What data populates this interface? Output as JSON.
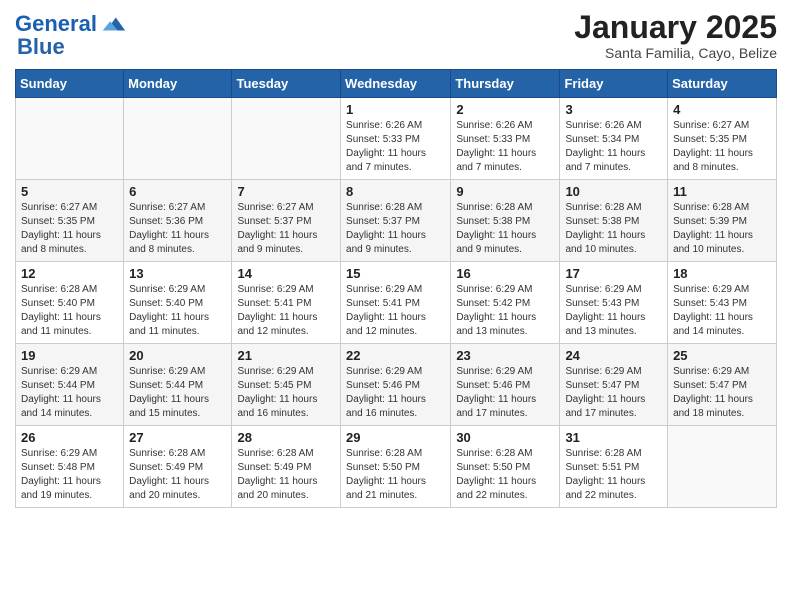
{
  "header": {
    "logo_line1": "General",
    "logo_line2": "Blue",
    "month_title": "January 2025",
    "subtitle": "Santa Familia, Cayo, Belize"
  },
  "weekdays": [
    "Sunday",
    "Monday",
    "Tuesday",
    "Wednesday",
    "Thursday",
    "Friday",
    "Saturday"
  ],
  "weeks": [
    [
      {
        "day": "",
        "sunrise": "",
        "sunset": "",
        "daylight": ""
      },
      {
        "day": "",
        "sunrise": "",
        "sunset": "",
        "daylight": ""
      },
      {
        "day": "",
        "sunrise": "",
        "sunset": "",
        "daylight": ""
      },
      {
        "day": "1",
        "sunrise": "Sunrise: 6:26 AM",
        "sunset": "Sunset: 5:33 PM",
        "daylight": "Daylight: 11 hours and 7 minutes."
      },
      {
        "day": "2",
        "sunrise": "Sunrise: 6:26 AM",
        "sunset": "Sunset: 5:33 PM",
        "daylight": "Daylight: 11 hours and 7 minutes."
      },
      {
        "day": "3",
        "sunrise": "Sunrise: 6:26 AM",
        "sunset": "Sunset: 5:34 PM",
        "daylight": "Daylight: 11 hours and 7 minutes."
      },
      {
        "day": "4",
        "sunrise": "Sunrise: 6:27 AM",
        "sunset": "Sunset: 5:35 PM",
        "daylight": "Daylight: 11 hours and 8 minutes."
      }
    ],
    [
      {
        "day": "5",
        "sunrise": "Sunrise: 6:27 AM",
        "sunset": "Sunset: 5:35 PM",
        "daylight": "Daylight: 11 hours and 8 minutes."
      },
      {
        "day": "6",
        "sunrise": "Sunrise: 6:27 AM",
        "sunset": "Sunset: 5:36 PM",
        "daylight": "Daylight: 11 hours and 8 minutes."
      },
      {
        "day": "7",
        "sunrise": "Sunrise: 6:27 AM",
        "sunset": "Sunset: 5:37 PM",
        "daylight": "Daylight: 11 hours and 9 minutes."
      },
      {
        "day": "8",
        "sunrise": "Sunrise: 6:28 AM",
        "sunset": "Sunset: 5:37 PM",
        "daylight": "Daylight: 11 hours and 9 minutes."
      },
      {
        "day": "9",
        "sunrise": "Sunrise: 6:28 AM",
        "sunset": "Sunset: 5:38 PM",
        "daylight": "Daylight: 11 hours and 9 minutes."
      },
      {
        "day": "10",
        "sunrise": "Sunrise: 6:28 AM",
        "sunset": "Sunset: 5:38 PM",
        "daylight": "Daylight: 11 hours and 10 minutes."
      },
      {
        "day": "11",
        "sunrise": "Sunrise: 6:28 AM",
        "sunset": "Sunset: 5:39 PM",
        "daylight": "Daylight: 11 hours and 10 minutes."
      }
    ],
    [
      {
        "day": "12",
        "sunrise": "Sunrise: 6:28 AM",
        "sunset": "Sunset: 5:40 PM",
        "daylight": "Daylight: 11 hours and 11 minutes."
      },
      {
        "day": "13",
        "sunrise": "Sunrise: 6:29 AM",
        "sunset": "Sunset: 5:40 PM",
        "daylight": "Daylight: 11 hours and 11 minutes."
      },
      {
        "day": "14",
        "sunrise": "Sunrise: 6:29 AM",
        "sunset": "Sunset: 5:41 PM",
        "daylight": "Daylight: 11 hours and 12 minutes."
      },
      {
        "day": "15",
        "sunrise": "Sunrise: 6:29 AM",
        "sunset": "Sunset: 5:41 PM",
        "daylight": "Daylight: 11 hours and 12 minutes."
      },
      {
        "day": "16",
        "sunrise": "Sunrise: 6:29 AM",
        "sunset": "Sunset: 5:42 PM",
        "daylight": "Daylight: 11 hours and 13 minutes."
      },
      {
        "day": "17",
        "sunrise": "Sunrise: 6:29 AM",
        "sunset": "Sunset: 5:43 PM",
        "daylight": "Daylight: 11 hours and 13 minutes."
      },
      {
        "day": "18",
        "sunrise": "Sunrise: 6:29 AM",
        "sunset": "Sunset: 5:43 PM",
        "daylight": "Daylight: 11 hours and 14 minutes."
      }
    ],
    [
      {
        "day": "19",
        "sunrise": "Sunrise: 6:29 AM",
        "sunset": "Sunset: 5:44 PM",
        "daylight": "Daylight: 11 hours and 14 minutes."
      },
      {
        "day": "20",
        "sunrise": "Sunrise: 6:29 AM",
        "sunset": "Sunset: 5:44 PM",
        "daylight": "Daylight: 11 hours and 15 minutes."
      },
      {
        "day": "21",
        "sunrise": "Sunrise: 6:29 AM",
        "sunset": "Sunset: 5:45 PM",
        "daylight": "Daylight: 11 hours and 16 minutes."
      },
      {
        "day": "22",
        "sunrise": "Sunrise: 6:29 AM",
        "sunset": "Sunset: 5:46 PM",
        "daylight": "Daylight: 11 hours and 16 minutes."
      },
      {
        "day": "23",
        "sunrise": "Sunrise: 6:29 AM",
        "sunset": "Sunset: 5:46 PM",
        "daylight": "Daylight: 11 hours and 17 minutes."
      },
      {
        "day": "24",
        "sunrise": "Sunrise: 6:29 AM",
        "sunset": "Sunset: 5:47 PM",
        "daylight": "Daylight: 11 hours and 17 minutes."
      },
      {
        "day": "25",
        "sunrise": "Sunrise: 6:29 AM",
        "sunset": "Sunset: 5:47 PM",
        "daylight": "Daylight: 11 hours and 18 minutes."
      }
    ],
    [
      {
        "day": "26",
        "sunrise": "Sunrise: 6:29 AM",
        "sunset": "Sunset: 5:48 PM",
        "daylight": "Daylight: 11 hours and 19 minutes."
      },
      {
        "day": "27",
        "sunrise": "Sunrise: 6:28 AM",
        "sunset": "Sunset: 5:49 PM",
        "daylight": "Daylight: 11 hours and 20 minutes."
      },
      {
        "day": "28",
        "sunrise": "Sunrise: 6:28 AM",
        "sunset": "Sunset: 5:49 PM",
        "daylight": "Daylight: 11 hours and 20 minutes."
      },
      {
        "day": "29",
        "sunrise": "Sunrise: 6:28 AM",
        "sunset": "Sunset: 5:50 PM",
        "daylight": "Daylight: 11 hours and 21 minutes."
      },
      {
        "day": "30",
        "sunrise": "Sunrise: 6:28 AM",
        "sunset": "Sunset: 5:50 PM",
        "daylight": "Daylight: 11 hours and 22 minutes."
      },
      {
        "day": "31",
        "sunrise": "Sunrise: 6:28 AM",
        "sunset": "Sunset: 5:51 PM",
        "daylight": "Daylight: 11 hours and 22 minutes."
      },
      {
        "day": "",
        "sunrise": "",
        "sunset": "",
        "daylight": ""
      }
    ]
  ]
}
